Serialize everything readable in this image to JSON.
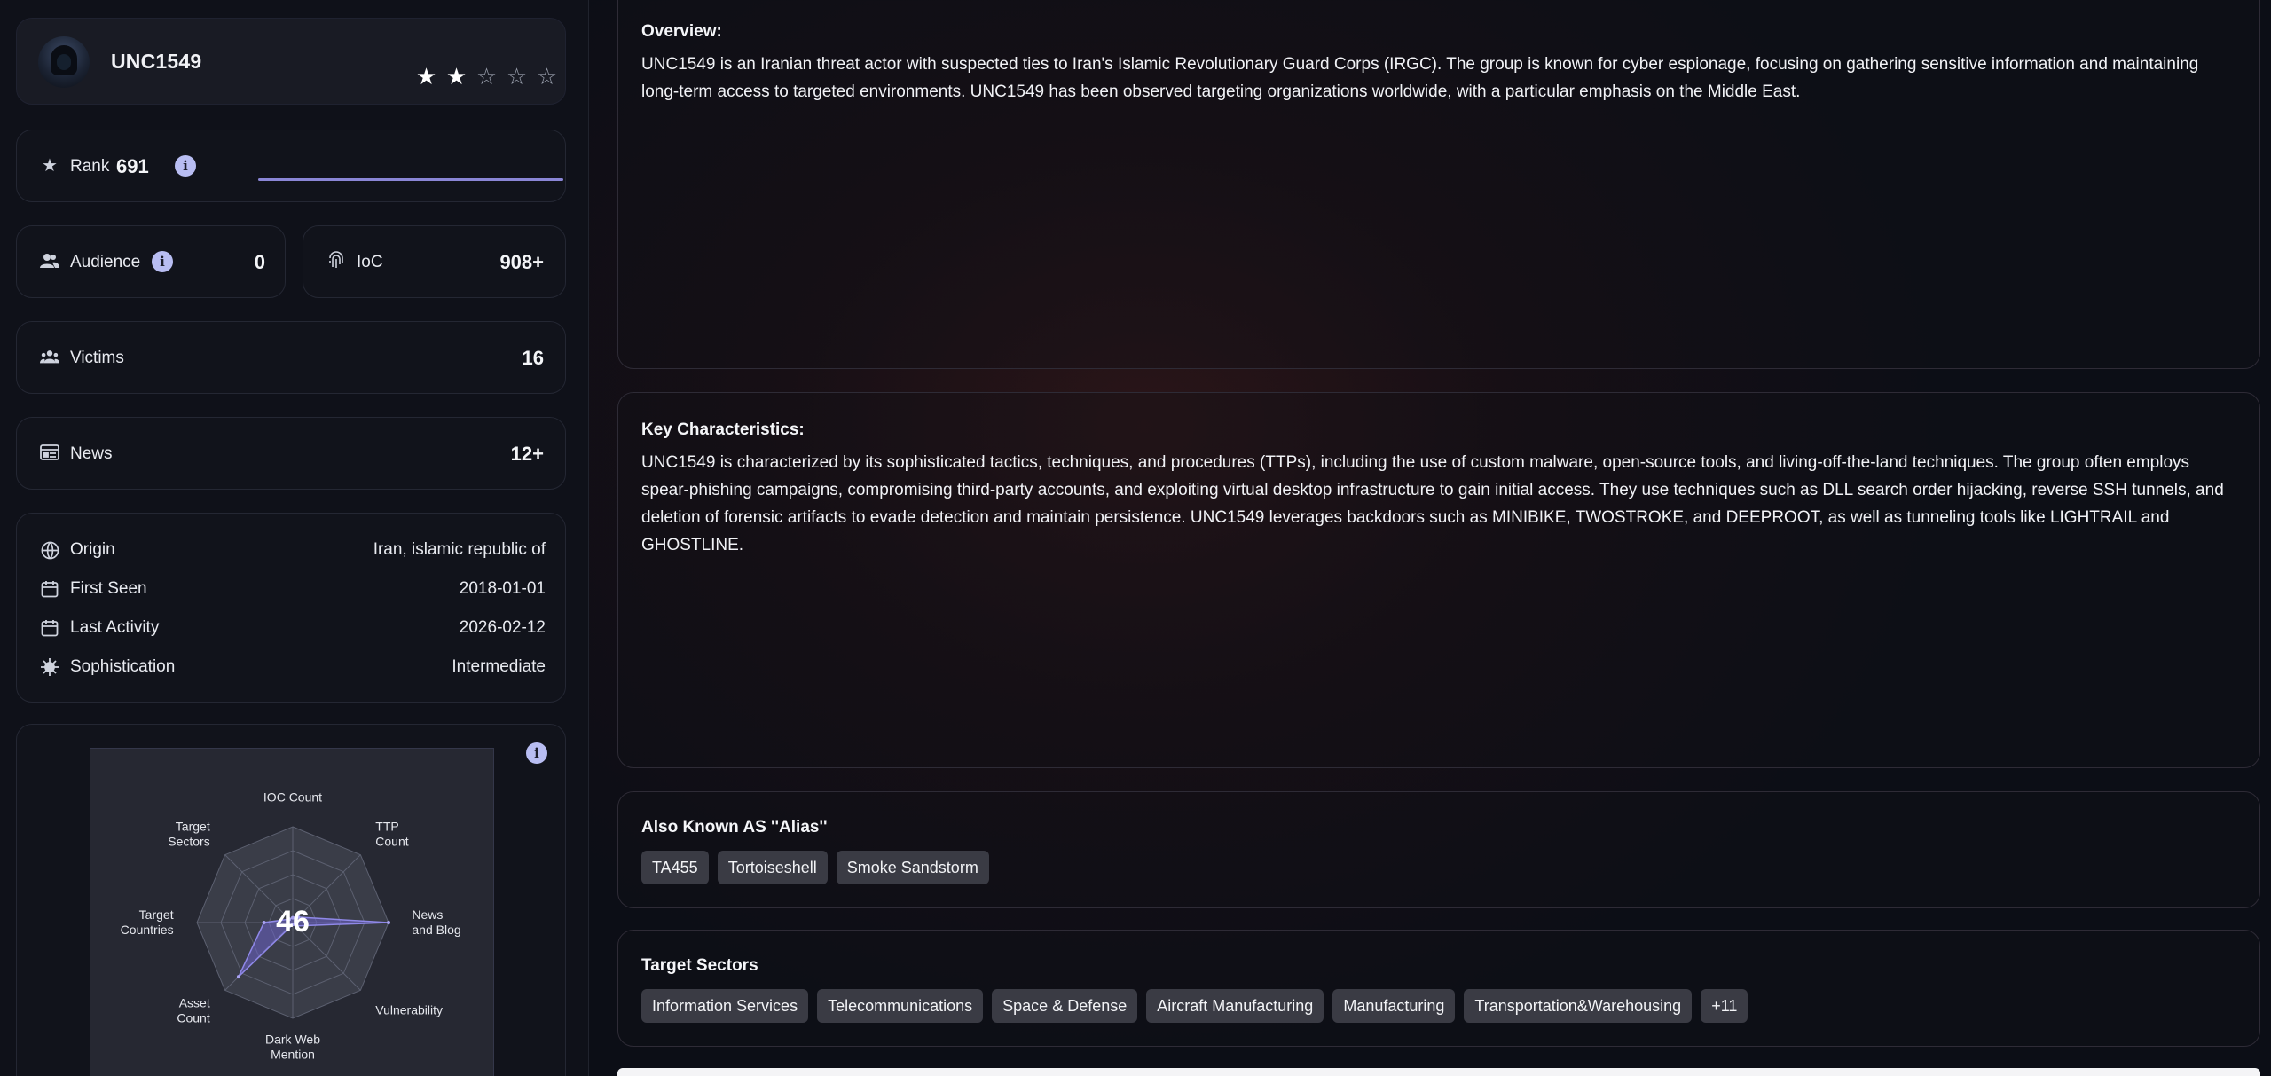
{
  "actor": {
    "name": "UNC1549",
    "rating": 2,
    "rating_max": 5
  },
  "rank": {
    "label": "Rank",
    "value": "691"
  },
  "audience": {
    "label": "Audience",
    "value": "0"
  },
  "ioc": {
    "label": "IoC",
    "value": "908+"
  },
  "victims": {
    "label": "Victims",
    "value": "16"
  },
  "news": {
    "label": "News",
    "value": "12+"
  },
  "details": [
    {
      "label": "Origin",
      "value": "Iran, islamic republic of",
      "icon": "globe-icon"
    },
    {
      "label": "First Seen",
      "value": "2018-01-01",
      "icon": "calendar-icon"
    },
    {
      "label": "Last Activity",
      "value": "2026-02-12",
      "icon": "calendar-icon"
    },
    {
      "label": "Sophistication",
      "value": "Intermediate",
      "icon": "virus-icon"
    }
  ],
  "radar": {
    "score": "46",
    "axes": [
      "IOC Count",
      "TTP Count",
      "News and Blog",
      "Vulnerability",
      "Dark Web Mention",
      "Asset Count",
      "Target Countries",
      "Target Sectors"
    ],
    "axis_lines": [
      [
        "IOC Count"
      ],
      [
        "TTP",
        "Count"
      ],
      [
        "News",
        "and Blog"
      ],
      [
        "Vulnerability"
      ],
      [
        "Dark Web",
        "Mention"
      ],
      [
        "Asset",
        "Count"
      ],
      [
        "Target",
        "Countries"
      ],
      [
        "Target",
        "Sectors"
      ]
    ],
    "values": [
      0.05,
      0.08,
      1.0,
      0.05,
      0.0,
      0.8,
      0.3,
      0.05
    ],
    "fill_color": "#6c63c8"
  },
  "overview": {
    "title": "Overview:",
    "text": "UNC1549 is an Iranian threat actor with suspected ties to Iran's Islamic Revolutionary Guard Corps (IRGC). The group is known for cyber espionage, focusing on gathering sensitive information and maintaining long-term access to targeted environments. UNC1549 has been observed targeting organizations worldwide, with a particular emphasis on the Middle East."
  },
  "key_characteristics": {
    "title": "Key Characteristics:",
    "text": "UNC1549 is characterized by its sophisticated tactics, techniques, and procedures (TTPs), including the use of custom malware, open-source tools, and living-off-the-land techniques. The group often employs spear-phishing campaigns, compromising third-party accounts, and exploiting virtual desktop infrastructure to gain initial access. They use techniques such as DLL search order hijacking, reverse SSH tunnels, and deletion of forensic artifacts to evade detection and maintain persistence. UNC1549 leverages backdoors such as MINIBIKE, TWOSTROKE, and DEEPROOT, as well as tunneling tools like LIGHTRAIL and GHOSTLINE."
  },
  "aliases": {
    "title": "Also Known AS ''Alias''",
    "items": [
      "TA455",
      "Tortoiseshell",
      "Smoke Sandstorm"
    ]
  },
  "target_sectors": {
    "title": "Target Sectors",
    "items": [
      "Information Services",
      "Telecommunications",
      "Space & Defense",
      "Aircraft Manufacturing",
      "Manufacturing",
      "Transportation&Warehousing",
      "+11"
    ]
  }
}
